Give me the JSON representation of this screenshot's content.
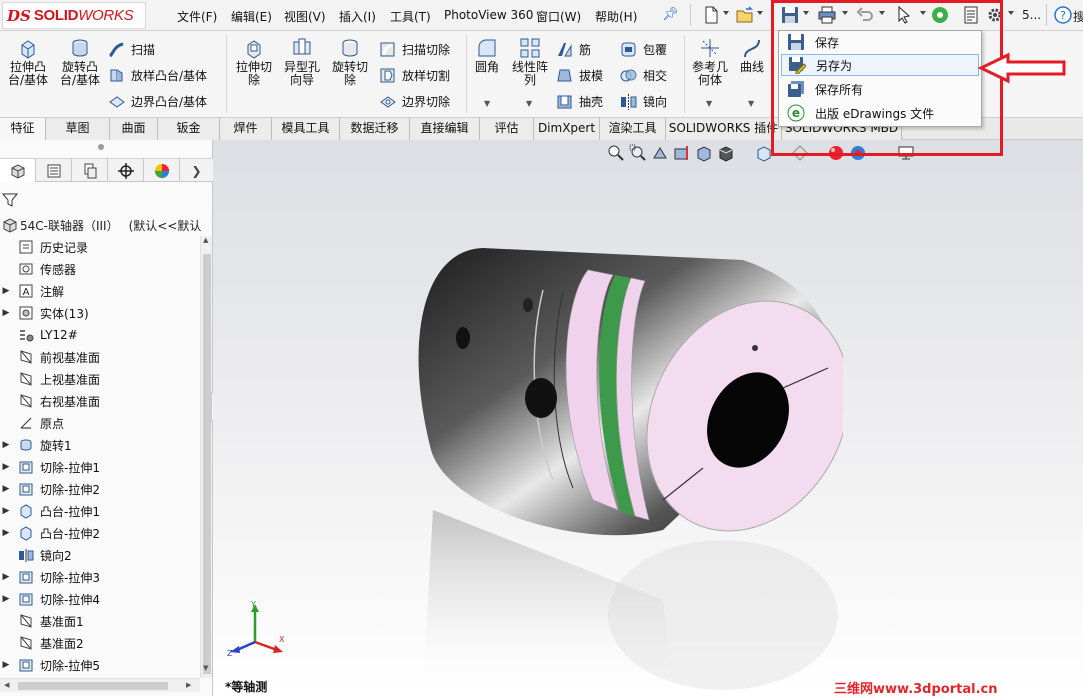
{
  "app": {
    "logo_mark": "DS",
    "logo_text_bold": "SOLID",
    "logo_text_light": "WORKS"
  },
  "menu": {
    "items": [
      "文件(F)",
      "编辑(E)",
      "视图(V)",
      "插入(I)",
      "工具(T)",
      "PhotoView 360",
      "窗口(W)",
      "帮助(H)"
    ],
    "truncated_right": "搜",
    "quick_text": "5..."
  },
  "ribbon": {
    "extrude_boss": "拉伸凸\n台/基体",
    "revolve_boss": "旋转凸\n台/基体",
    "sweep": "扫描",
    "loft_boss": "放样凸台/基体",
    "boundary_boss": "边界凸台/基体",
    "extrude_cut": "拉伸切\n除",
    "hole_wizard": "异型孔\n向导",
    "revolve_cut": "旋转切\n除",
    "swept_cut": "扫描切除",
    "lofted_cut": "放样切割",
    "boundary_cut": "边界切除",
    "fillet": "圆角",
    "linear_pattern": "线性阵\n列",
    "rib": "筋",
    "draft": "拔模",
    "shell": "抽壳",
    "wrap": "包覆",
    "intersect": "相交",
    "mirror": "镜向",
    "ref_geometry": "参考几\n何体",
    "curves": "曲线"
  },
  "tabs": [
    "特征",
    "草图",
    "曲面",
    "钣金",
    "焊件",
    "模具工具",
    "数据迁移",
    "直接编辑",
    "评估",
    "DimXpert",
    "渲染工具",
    "SOLIDWORKS 插件",
    "SOLIDWORKS MBD"
  ],
  "tree": {
    "root": "54C-联轴器（III）",
    "root_config": "(默认<<默认",
    "nodes": [
      {
        "label": "历史记录",
        "icon": "history-icon",
        "expandable": false
      },
      {
        "label": "传感器",
        "icon": "sensor-icon",
        "expandable": false
      },
      {
        "label": "注解",
        "icon": "annotation-icon",
        "expandable": true
      },
      {
        "label": "实体(13)",
        "icon": "solid-bodies-icon",
        "expandable": true
      },
      {
        "label": "LY12#",
        "icon": "material-icon",
        "expandable": false
      },
      {
        "label": "前视基准面",
        "icon": "plane-icon",
        "expandable": false
      },
      {
        "label": "上视基准面",
        "icon": "plane-icon",
        "expandable": false
      },
      {
        "label": "右视基准面",
        "icon": "plane-icon",
        "expandable": false
      },
      {
        "label": "原点",
        "icon": "origin-icon",
        "expandable": false
      },
      {
        "label": "旋转1",
        "icon": "revolve-feature-icon",
        "expandable": true
      },
      {
        "label": "切除-拉伸1",
        "icon": "cut-extrude-icon",
        "expandable": true
      },
      {
        "label": "切除-拉伸2",
        "icon": "cut-extrude-icon",
        "expandable": true
      },
      {
        "label": "凸台-拉伸1",
        "icon": "boss-extrude-icon",
        "expandable": true
      },
      {
        "label": "凸台-拉伸2",
        "icon": "boss-extrude-icon",
        "expandable": true
      },
      {
        "label": "镜向2",
        "icon": "mirror-feature-icon",
        "expandable": false
      },
      {
        "label": "切除-拉伸3",
        "icon": "cut-extrude-icon",
        "expandable": true
      },
      {
        "label": "切除-拉伸4",
        "icon": "cut-extrude-icon",
        "expandable": true
      },
      {
        "label": "基准面1",
        "icon": "plane-icon",
        "expandable": false
      },
      {
        "label": "基准面2",
        "icon": "plane-icon",
        "expandable": false
      },
      {
        "label": "切除-拉伸5",
        "icon": "cut-extrude-icon",
        "expandable": true
      }
    ]
  },
  "viewport": {
    "view_label": "*等轴测",
    "triad_x": "X",
    "triad_y": "Y",
    "triad_z": "Z",
    "watermark": "三维网www.3dportal.cn"
  },
  "save_menu": {
    "items": [
      {
        "label": "保存",
        "icon": "save-icon"
      },
      {
        "label": "另存为",
        "icon": "save-as-icon",
        "highlighted": true
      },
      {
        "label": "保存所有",
        "icon": "save-all-icon"
      },
      {
        "label": "出版 eDrawings 文件",
        "icon": "edrawings-icon"
      }
    ]
  },
  "colors": {
    "annotation_red": "#e31c24",
    "brand_red": "#d2141e",
    "coupling_pink": "#f0d2ec",
    "coupling_green": "#3c9a4a"
  }
}
